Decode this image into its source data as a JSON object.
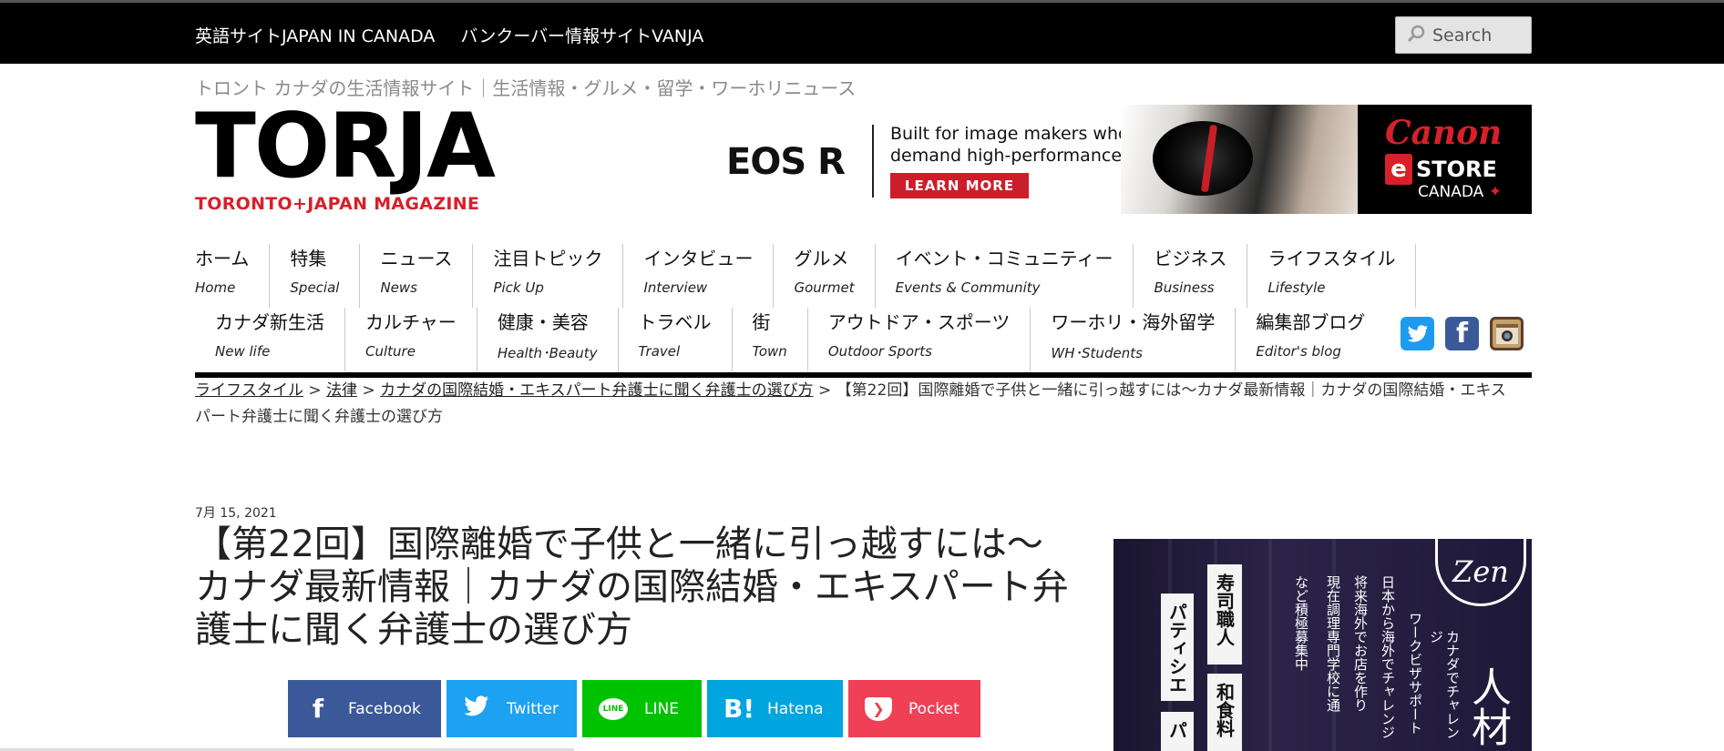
{
  "topbar": {
    "links": [
      "英語サイトJAPAN IN CANADA",
      "バンクーバー情報サイトVANJA"
    ],
    "search_placeholder": "Search",
    "search_icon": "search-icon"
  },
  "tagline": "トロント カナダの生活情報サイト｜生活情報・グルメ・留学・ワーホリニュース",
  "logo": {
    "main": "TORJA",
    "sub": "TORONTO+JAPAN MAGAZINE"
  },
  "banner_ad": {
    "product": "EOS R",
    "text": "Built for image makers who demand high-performance",
    "cta": "LEARN MORE",
    "brand": "Canon",
    "store_badge": "e",
    "store": "STORE",
    "country": "CANADA"
  },
  "nav": {
    "row1": [
      {
        "ja": "ホーム",
        "en": "Home"
      },
      {
        "ja": "特集",
        "en": "Special"
      },
      {
        "ja": "ニュース",
        "en": "News"
      },
      {
        "ja": "注目トピック",
        "en": "Pick Up"
      },
      {
        "ja": "インタビュー",
        "en": "Interview"
      },
      {
        "ja": "グルメ",
        "en": "Gourmet"
      },
      {
        "ja": "イベント・コミュニティー",
        "en": "Events & Community"
      },
      {
        "ja": "ビジネス",
        "en": "Business"
      },
      {
        "ja": "ライフスタイル",
        "en": "Lifestyle"
      }
    ],
    "row2": [
      {
        "ja": "カナダ新生活",
        "en": "New life"
      },
      {
        "ja": "カルチャー",
        "en": "Culture"
      },
      {
        "ja": "健康・美容",
        "en": "Health･Beauty"
      },
      {
        "ja": "トラベル",
        "en": "Travel"
      },
      {
        "ja": "街",
        "en": "Town"
      },
      {
        "ja": "アウトドア・スポーツ",
        "en": "Outdoor Sports"
      },
      {
        "ja": "ワーホリ・海外留学",
        "en": "WH･Students"
      },
      {
        "ja": "編集部ブログ",
        "en": "Editor's blog"
      }
    ],
    "social": [
      "twitter-icon",
      "facebook-icon",
      "instagram-icon"
    ]
  },
  "breadcrumb": {
    "links": [
      "ライフスタイル",
      "法律",
      "カナダの国際結婚・エキスパート弁護士に聞く弁護士の選び方"
    ],
    "separator": ">",
    "current": "【第22回】国際離婚で子供と一緒に引っ越すには～カナダ最新情報｜カナダの国際結婚・エキスパート弁護士に聞く弁護士の選び方"
  },
  "article": {
    "date": "7月 15, 2021",
    "title": "【第22回】国際離婚で子供と一緒に引っ越すには～カナダ最新情報｜カナダの国際結婚・エキスパート弁護士に聞く弁護士の選び方"
  },
  "share": [
    {
      "label": "Facebook",
      "glyph": "f",
      "color": "#3b5998"
    },
    {
      "label": "Twitter",
      "glyph": "",
      "color": "#1da1f2"
    },
    {
      "label": "LINE",
      "glyph": "LINE",
      "color": "#00c300"
    },
    {
      "label": "Hatena",
      "glyph": "B!",
      "color": "#00a4de"
    },
    {
      "label": "Pocket",
      "glyph": "",
      "color": "#ef4056"
    }
  ],
  "side_ad": {
    "logo": "Zen",
    "headline": "人材",
    "tagline_vertical": [
      "カナダでチャレンジ",
      "ワークビザサポート"
    ],
    "checks": [
      "日本から海外でチャレンジ",
      "将来海外でお店を作り",
      "現在調理専門学校に通",
      "など積極募集中"
    ],
    "cards": [
      "寿司職人",
      "パティシエ",
      "和食料",
      "パ"
    ]
  }
}
